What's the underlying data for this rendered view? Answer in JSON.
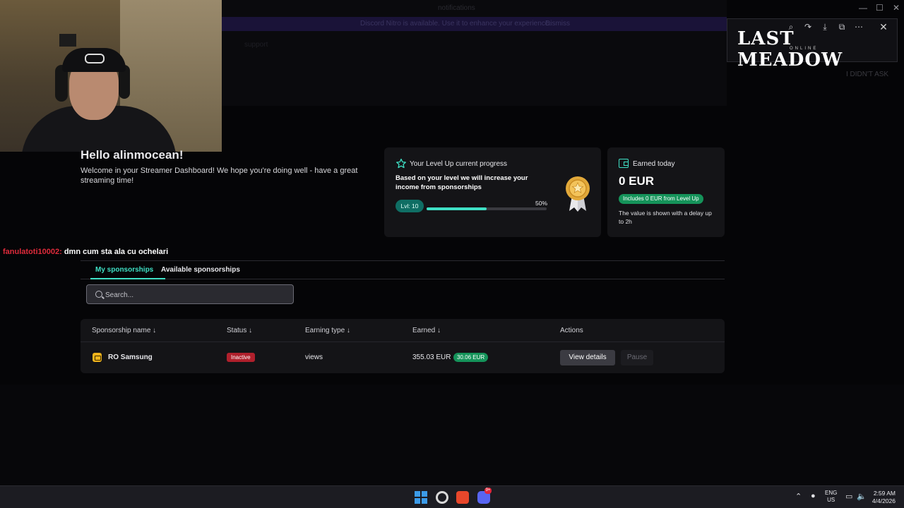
{
  "background_window": {
    "title": "notifications",
    "banner_text": "Discord Nitro is available. Use it to enhance your experience.",
    "banner_button": "Dismiss",
    "channel": "support"
  },
  "overlay": {
    "game_logo": "LAST MEADOW",
    "game_logo_sub": "ONLINE",
    "side_text": "I DIDN'T ASK",
    "icons": [
      "zoom-icon",
      "redo-icon",
      "download-icon",
      "popout-icon",
      "more-icon",
      "close-icon"
    ]
  },
  "dashboard": {
    "greeting": "Hello alinmocean!",
    "welcome": "Welcome in your Streamer Dashboard! We hope you're doing well - have a great streaming time!",
    "levelup": {
      "title": "Your Level Up current progress",
      "description": "Based on your level we will increase your income from sponsorships",
      "level_label": "Lvl: 10",
      "progress_label": "50%",
      "progress_fraction": 0.5
    },
    "earned_today": {
      "title": "Earned today",
      "amount": "0 EUR",
      "includes": "Includes 0 EUR from Level Up",
      "note": "The value is shown with a delay up to 2h"
    },
    "tabs": [
      {
        "label": "My sponsorships",
        "active": true
      },
      {
        "label": "Available sponsorships",
        "active": false
      }
    ],
    "search_placeholder": "Search...",
    "table": {
      "headers": [
        "Sponsorship name ↓",
        "Status ↓",
        "Earning type ↓",
        "Earned ↓",
        "Actions"
      ],
      "rows": [
        {
          "name": "RO Samsung",
          "status": "Inactive",
          "earning_type": "views",
          "earned": "355.03 EUR",
          "earned_badge": "30.06 EUR",
          "details_label": "View details",
          "pause_label": "Pause"
        }
      ]
    }
  },
  "chat": {
    "user": "fanulatoti10002:",
    "message": "dmn cum sta ala cu ochelari"
  },
  "taskbar": {
    "badge": "9+",
    "lang_line1": "ENG",
    "lang_line2": "US",
    "time": "2:59 AM",
    "date": "4/4/2026"
  },
  "colors": {
    "accent": "#3fe0c5",
    "success": "#15935a",
    "danger": "#b0202c",
    "chat_user": "#e02b3b"
  }
}
